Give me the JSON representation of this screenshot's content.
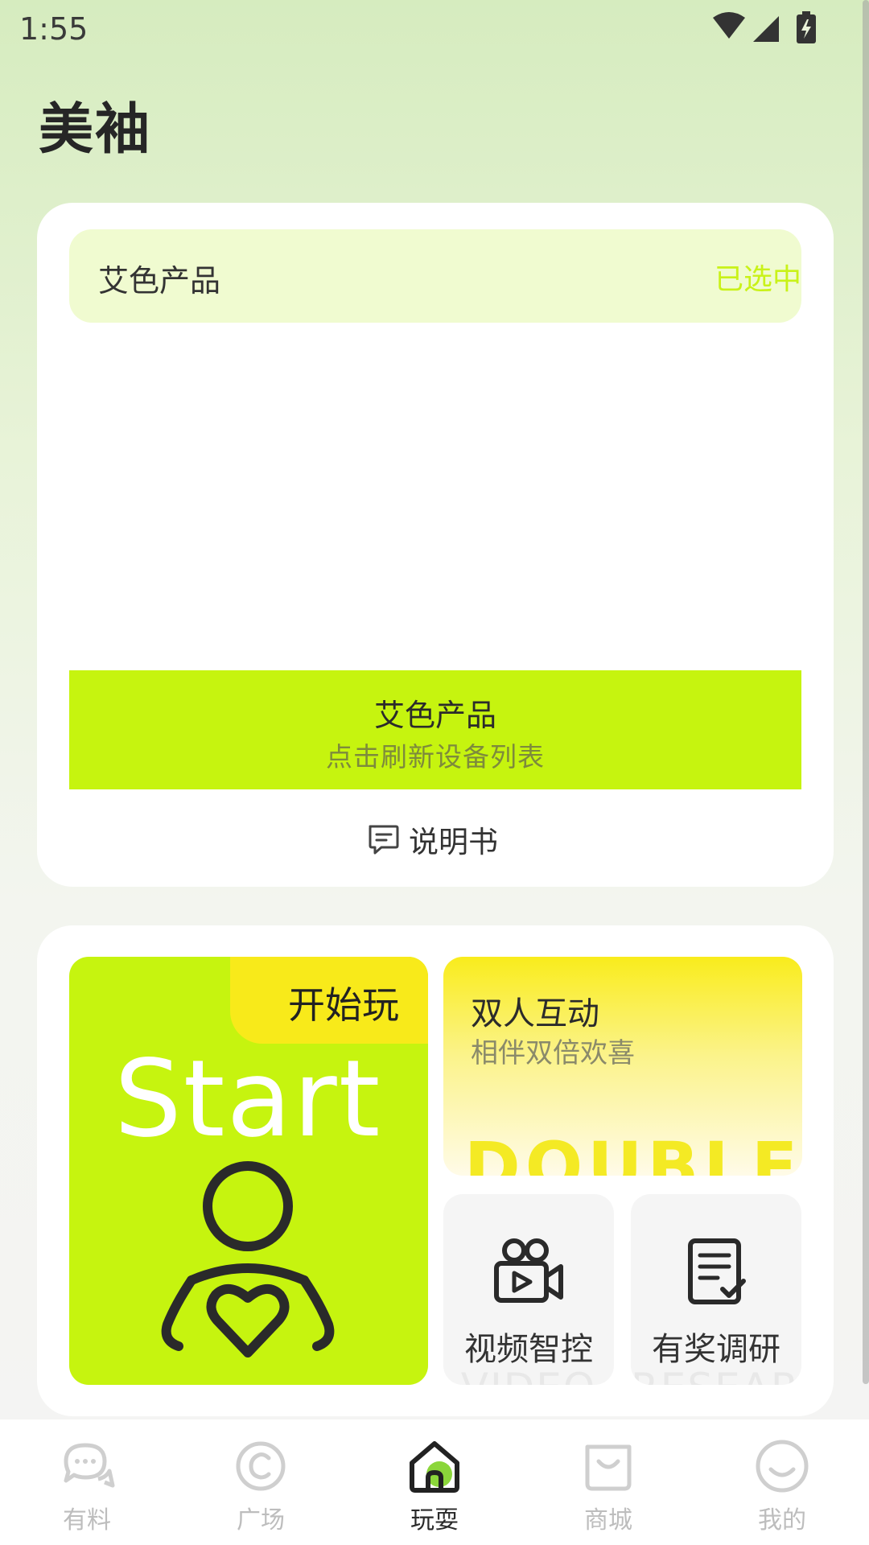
{
  "status_bar": {
    "time": "1:55"
  },
  "app": {
    "title": "美袖"
  },
  "device_card": {
    "product_name": "艾色产品",
    "selected_label": "已选中",
    "refresh_title": "艾色产品",
    "refresh_subtitle": "点击刷新设备列表",
    "manual_label": "说明书"
  },
  "features": {
    "start": {
      "tab_label": "开始玩",
      "word": "Start"
    },
    "double": {
      "title": "双人互动",
      "subtitle": "相伴双倍欢喜",
      "word": "DOUBLE"
    },
    "video": {
      "label": "视频智控",
      "watermark": "VIDEO"
    },
    "survey": {
      "label": "有奖调研",
      "watermark": "RESEARCH"
    }
  },
  "bottom_nav": {
    "items": [
      {
        "label": "有料",
        "icon": "chat-bubbles-icon"
      },
      {
        "label": "广场",
        "icon": "circle-c-icon"
      },
      {
        "label": "玩耍",
        "icon": "home-icon",
        "active": true
      },
      {
        "label": "商城",
        "icon": "shopping-bag-icon"
      },
      {
        "label": "我的",
        "icon": "smiley-icon"
      }
    ]
  },
  "colors": {
    "accent_lime": "#c6f40f",
    "accent_yellow": "#f8ea1a",
    "selected_text": "#c9f218"
  }
}
